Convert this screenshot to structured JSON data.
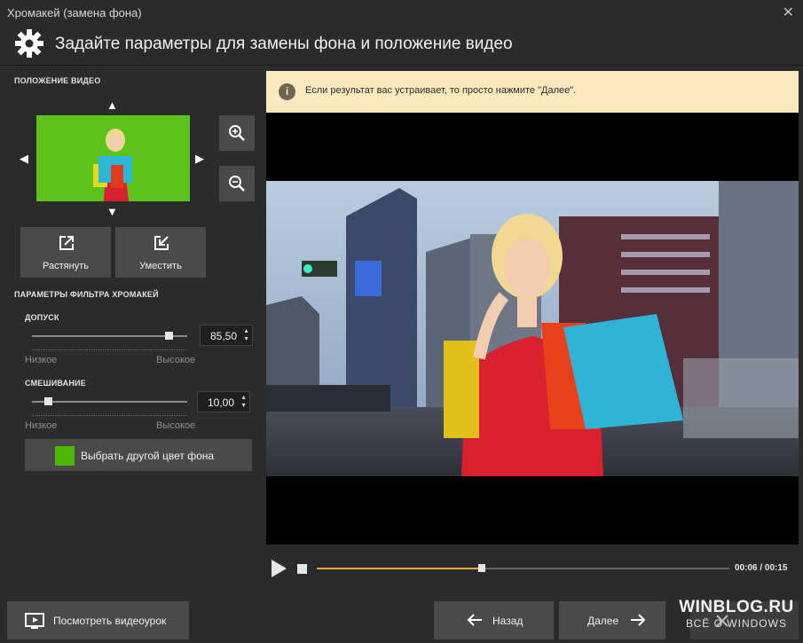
{
  "window": {
    "title": "Хромакей (замена фона)",
    "close_icon": "close-icon"
  },
  "header": {
    "title": "Задайте параметры для замены фона и положение видео",
    "icon": "gear-icon"
  },
  "position": {
    "label": "ПОЛОЖЕНИЕ ВИДЕО",
    "stretch_label": "Растянуть",
    "fit_label": "Уместить"
  },
  "filter": {
    "label": "ПАРАМЕТРЫ ФИЛЬТРА ХРОМАКЕЙ",
    "tolerance": {
      "label": "ДОПУСК",
      "value": "85,50",
      "level": 0.88,
      "low": "Низкое",
      "high": "Высокое"
    },
    "blend": {
      "label": "СМЕШИВАНИЕ",
      "value": "10,00",
      "level": 0.1,
      "low": "Низкое",
      "high": "Высокое"
    },
    "color_button_label": "Выбрать другой цвет фона",
    "key_color": "#4fb800"
  },
  "info": {
    "message": "Если результат вас устраивает, то просто нажмите \"Далее\"."
  },
  "player": {
    "timecode": "00:06 / 00:15",
    "progress": 0.4,
    "accent": "#e8a63d"
  },
  "footer": {
    "tutorial_label": "Посмотреть видеоурок",
    "back_label": "Назад",
    "next_label": "Далее"
  },
  "watermark": {
    "line1": "WINBLOG.RU",
    "line2": "ВСЁ О WINDOWS"
  }
}
